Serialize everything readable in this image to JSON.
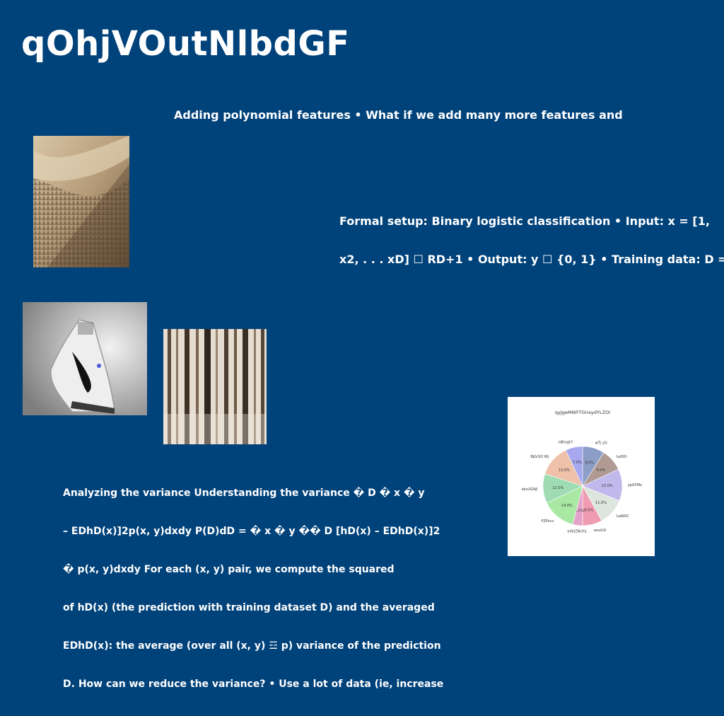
{
  "slide": {
    "title": "qOhjVOutNlbdGF",
    "text_1": "Adding polynomial features • What if we add many more features and",
    "text_2_lines": [
      "Formal setup: Binary logistic classification • Input: x = [1,",
      "x2, . . . xD] ☐ RD+1 • Output: y ☐ {0, 1} • Training data: D ="
    ],
    "text_3_lines": [
      "Analyzing the variance Understanding the variance � D � x � y",
      "– EDhD(x)]2p(x, y)dxdy P(D)dD = � x � y �� D [hD(x) – EDhD(x)]2",
      "� p(x, y)dxdy For each (x, y) pair, we compute the squared",
      "of hD(x) (the prediction with training dataset D) and the averaged",
      "EDhD(x): the average (over all (x, y) ☲ p) variance of the prediction",
      "D. How can we reduce the variance? • Use a lot of data (ie, increase"
    ],
    "images": [
      {
        "name": "foggy-forest-slope-photo"
      },
      {
        "name": "sneaker-photo"
      },
      {
        "name": "birch-trees-photo"
      }
    ]
  },
  "chart_data": {
    "type": "pie",
    "title": "qyJgeMWFTGiraydYLZOI",
    "labels": [
      "wTj yG",
      "lydSO",
      "ypGYMo",
      "LwNDC",
      "wovUU",
      "eXeiZNcfnj",
      "FZPsvv",
      "eksUGWj",
      "BjGrSO Wj",
      "nBhsgtY"
    ],
    "values": [
      9.0,
      9.0,
      13.0,
      11.0,
      8.0,
      4.0,
      14.0,
      12.0,
      13.0,
      7.0
    ],
    "value_labels": [
      "9.0%",
      "9.0%",
      "13.0%",
      "11.0%",
      "8.0%",
      "4.0%",
      "14.0%",
      "12.0%",
      "13.0%",
      "7.0%"
    ],
    "colors": [
      "#8c9ec7",
      "#b09a93",
      "#c1b8ec",
      "#dde5df",
      "#ef9cb0",
      "#e3a1c9",
      "#a8e8a3",
      "#9fdcb4",
      "#eec1a8",
      "#a7a8ef"
    ],
    "start_angle_deg": 90,
    "direction": "clockwise"
  }
}
